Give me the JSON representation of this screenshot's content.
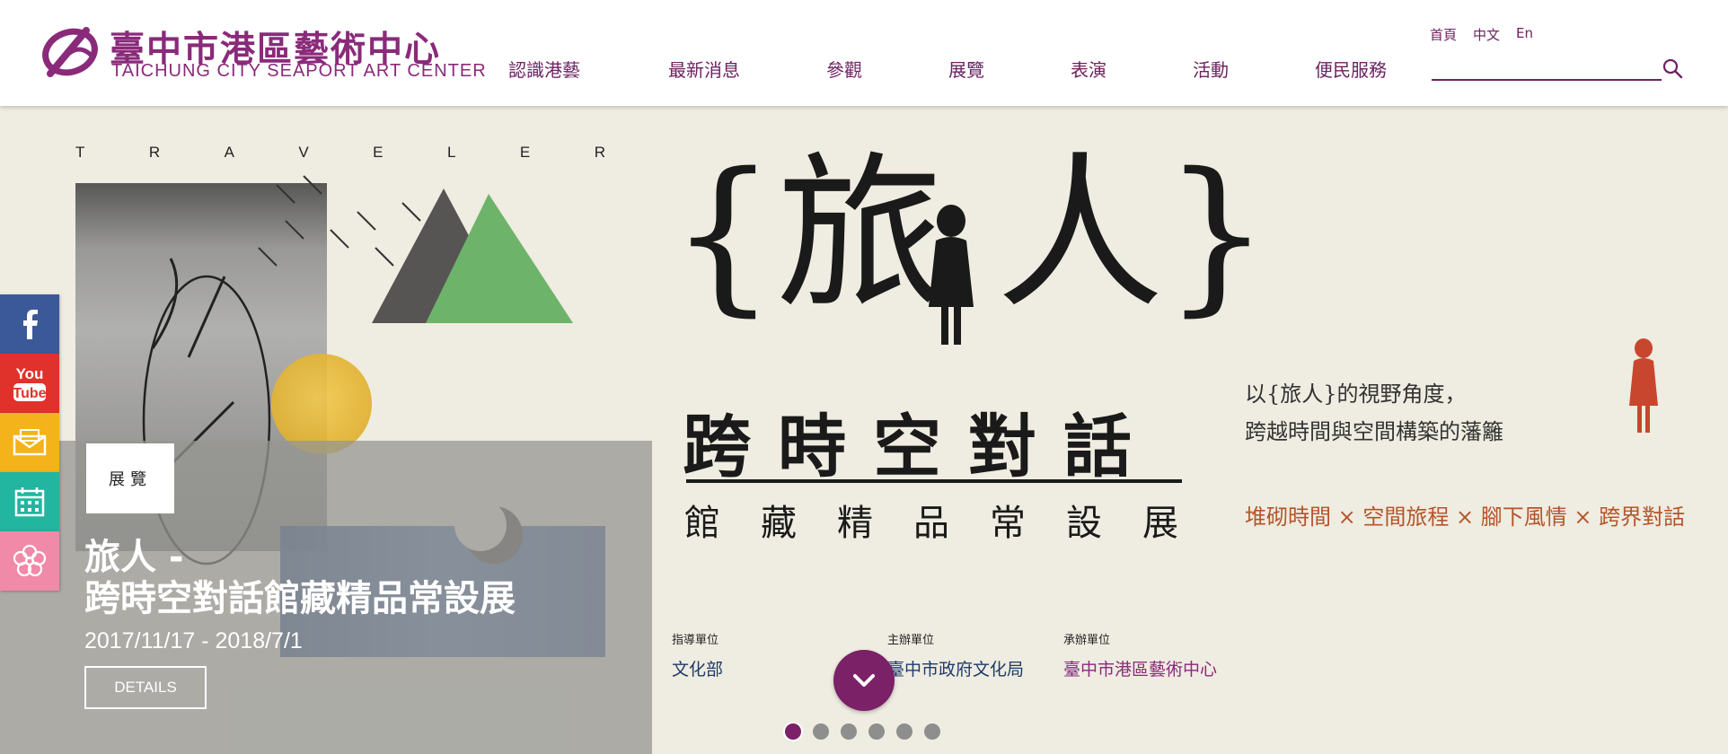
{
  "header": {
    "logo_cn": "臺中市港區藝術中心",
    "logo_en": "TAICHUNG CITY SEAPORT ART CENTER",
    "nav": [
      "認識港藝",
      "最新消息",
      "參觀",
      "展覽",
      "表演",
      "活動",
      "便民服務"
    ],
    "lang": [
      "首頁",
      "中文",
      "En"
    ],
    "search": {
      "placeholder": "",
      "value": ""
    }
  },
  "social": [
    {
      "name": "facebook-icon",
      "color": "#3b5998"
    },
    {
      "name": "youtube-icon",
      "label": "You Tube",
      "color": "#e0322b"
    },
    {
      "name": "mail-icon",
      "color": "#f4b21b"
    },
    {
      "name": "calendar-icon",
      "color": "#22b5a0"
    },
    {
      "name": "flower-icon",
      "color": "#f08aa8"
    }
  ],
  "banner": {
    "letters": [
      "T",
      "R",
      "A",
      "V",
      "E",
      "L",
      "E",
      "R"
    ],
    "main_title": "{旅 人}",
    "sub_title": "跨時空對話",
    "sub_title2": "館藏精品常設展",
    "desc_line1": "以{旅人}的視野角度，",
    "desc_line2": "跨越時間與空間構築的藩籬",
    "themes": "堆砌時間 × 空間旅程 × 腳下風情 × 跨界對話",
    "orgs": [
      {
        "label": "指導單位",
        "name": "文化部"
      },
      {
        "label": "主辦單位",
        "name": "臺中市政府文化局"
      },
      {
        "label": "承辦單位",
        "name": "臺中市港區藝術中心"
      }
    ],
    "overlay": {
      "tag": "展覽",
      "title_line1": "旅人 -",
      "title_line2": "跨時空對話館藏精品常設展",
      "date": "2017/11/17 - 2018/7/1",
      "details": "DETAILS"
    },
    "slides_total": 6,
    "slide_active": 1
  },
  "colors": {
    "brand": "#7b2168",
    "accent_orange": "#b4552a"
  }
}
